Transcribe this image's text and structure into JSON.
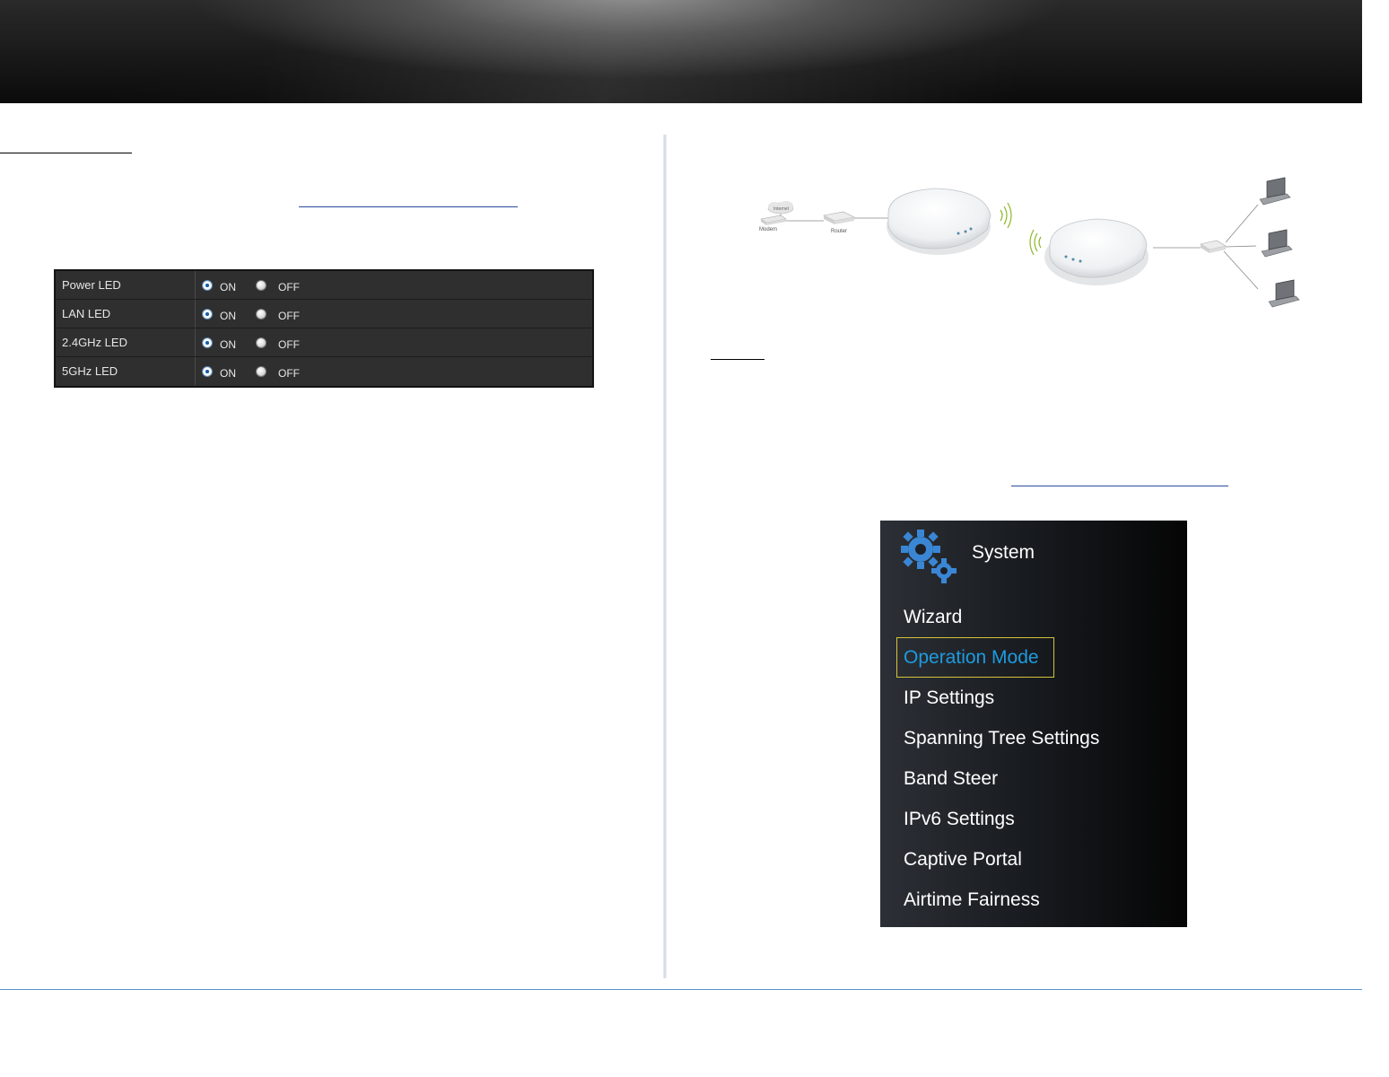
{
  "led_table": {
    "rows": [
      {
        "label": "Power LED",
        "on": "ON",
        "off": "OFF",
        "selected": "ON"
      },
      {
        "label": "LAN LED",
        "on": "ON",
        "off": "OFF",
        "selected": "ON"
      },
      {
        "label": "2.4GHz LED",
        "on": "ON",
        "off": "OFF",
        "selected": "ON"
      },
      {
        "label": "5GHz LED",
        "on": "ON",
        "off": "OFF",
        "selected": "ON"
      }
    ]
  },
  "diagram": {
    "internet_label": "Internet",
    "modem_label": "Modem",
    "router_label": "Router"
  },
  "system_menu": {
    "title": "System",
    "icon": "gears-icon",
    "items": [
      {
        "label": "Wizard"
      },
      {
        "label": "Operation Mode",
        "active": true
      },
      {
        "label": "IP Settings"
      },
      {
        "label": "Spanning Tree Settings"
      },
      {
        "label": "Band Steer"
      },
      {
        "label": "IPv6 Settings"
      },
      {
        "label": "Captive Portal"
      },
      {
        "label": "Airtime Fairness"
      }
    ],
    "active_color": "#1e9be0",
    "highlight_color": "#d4c33a"
  },
  "colors": {
    "footer_rule": "#5a8fd0",
    "link_underline": "#2a4a9a"
  }
}
